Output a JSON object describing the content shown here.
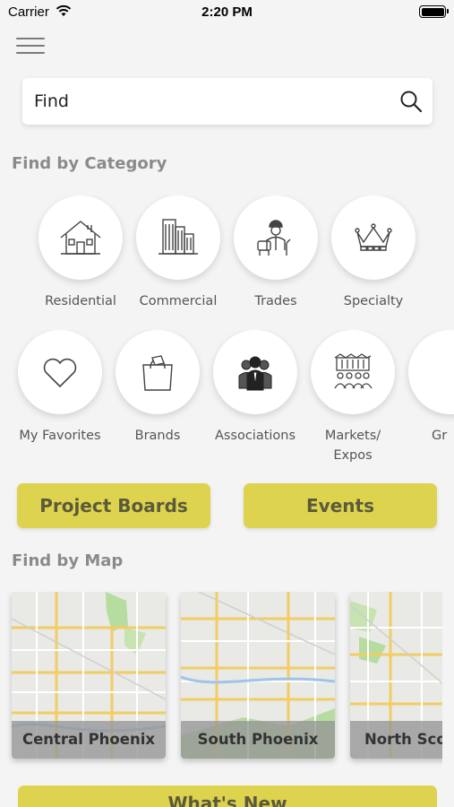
{
  "status_bar": {
    "carrier": "Carrier",
    "time": "2:20 PM"
  },
  "search": {
    "value": "Find"
  },
  "category_section": {
    "title": "Find by Category",
    "row1": [
      {
        "label": "Residential",
        "icon": "house-icon"
      },
      {
        "label": "Commercial",
        "icon": "buildings-icon"
      },
      {
        "label": "Trades",
        "icon": "worker-icon"
      },
      {
        "label": "Specialty",
        "icon": "crown-icon"
      }
    ],
    "row2": [
      {
        "label": "My Favorites",
        "icon": "heart-icon"
      },
      {
        "label": "Brands",
        "icon": "shopping-bag-icon"
      },
      {
        "label": "Associations",
        "icon": "people-group-icon"
      },
      {
        "label": "Markets/\nExpos",
        "icon": "market-crowd-icon"
      },
      {
        "label": "Gr",
        "icon": "partial-icon"
      }
    ]
  },
  "buttons": {
    "project_boards": "Project Boards",
    "events": "Events"
  },
  "map_section": {
    "title": "Find by Map",
    "cards": [
      {
        "label": "Central Phoenix"
      },
      {
        "label": "South Phoenix"
      },
      {
        "label": "North Scot"
      }
    ]
  },
  "bottom_button": {
    "label": "What's New"
  },
  "colors": {
    "accent": "#ddd34f",
    "button_text": "#5c5a3a",
    "background": "#f4f4f4"
  }
}
